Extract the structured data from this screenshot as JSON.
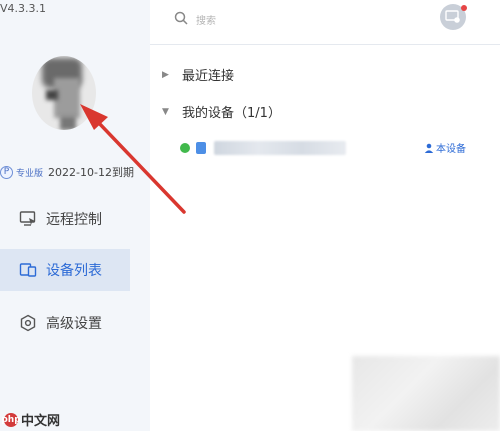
{
  "app": {
    "version": "V4.3.3.1"
  },
  "profile": {
    "badge_letter": "P",
    "tier": "专业版",
    "expire_text": "2022-10-12到期"
  },
  "sidebar": {
    "items": [
      {
        "label": "远程控制",
        "icon": "monitor-cursor-icon",
        "active": false
      },
      {
        "label": "设备列表",
        "icon": "devices-icon",
        "active": true
      },
      {
        "label": "高级设置",
        "icon": "gear-icon",
        "active": false
      }
    ]
  },
  "header": {
    "search_placeholder": "搜索"
  },
  "groups": {
    "recent": {
      "label": "最近连接"
    },
    "mine": {
      "label": "我的设备",
      "count": "（1/1）"
    }
  },
  "device": {
    "status": "online",
    "this_device_label": "本设备"
  },
  "colors": {
    "accent": "#2d6bd6",
    "online": "#41b94c",
    "annotation_arrow": "#d9372f"
  },
  "watermark": {
    "text": "中文网"
  }
}
